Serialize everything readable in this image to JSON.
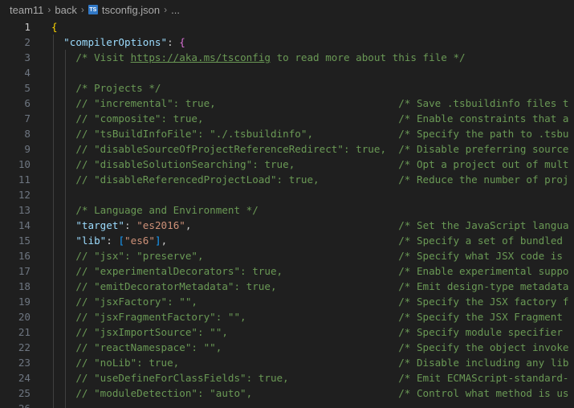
{
  "breadcrumb": {
    "items": [
      "team11",
      "back",
      "tsconfig.json",
      "..."
    ],
    "file_icon": "TS"
  },
  "editor": {
    "lines": [
      {
        "n": "1",
        "text": "{"
      },
      {
        "n": "2",
        "text": "  \"compilerOptions\": {"
      },
      {
        "n": "3",
        "text": "    /* Visit https://aka.ms/tsconfig to read more about this file */"
      },
      {
        "n": "4",
        "text": ""
      },
      {
        "n": "5",
        "text": "    /* Projects */"
      },
      {
        "n": "6",
        "text": "    // \"incremental\": true,                              /* Save .tsbuildinfo files t"
      },
      {
        "n": "7",
        "text": "    // \"composite\": true,                                /* Enable constraints that a"
      },
      {
        "n": "8",
        "text": "    // \"tsBuildInfoFile\": \"./.tsbuildinfo\",              /* Specify the path to .tsbu"
      },
      {
        "n": "9",
        "text": "    // \"disableSourceOfProjectReferenceRedirect\": true,  /* Disable preferring source"
      },
      {
        "n": "10",
        "text": "    // \"disableSolutionSearching\": true,                 /* Opt a project out of mult"
      },
      {
        "n": "11",
        "text": "    // \"disableReferencedProjectLoad\": true,             /* Reduce the number of proj"
      },
      {
        "n": "12",
        "text": ""
      },
      {
        "n": "13",
        "text": "    /* Language and Environment */"
      },
      {
        "n": "14",
        "text": "    \"target\": \"es2016\",                                  /* Set the JavaScript langua"
      },
      {
        "n": "15",
        "text": "    \"lib\": [\"es6\"],                                      /* Specify a set of bundled"
      },
      {
        "n": "16",
        "text": "    // \"jsx\": \"preserve\",                                /* Specify what JSX code is"
      },
      {
        "n": "17",
        "text": "    // \"experimentalDecorators\": true,                   /* Enable experimental suppo"
      },
      {
        "n": "18",
        "text": "    // \"emitDecoratorMetadata\": true,                    /* Emit design-type metadata"
      },
      {
        "n": "19",
        "text": "    // \"jsxFactory\": \"\",                                 /* Specify the JSX factory f"
      },
      {
        "n": "20",
        "text": "    // \"jsxFragmentFactory\": \"\",                         /* Specify the JSX Fragment"
      },
      {
        "n": "21",
        "text": "    // \"jsxImportSource\": \"\",                            /* Specify module specifier"
      },
      {
        "n": "22",
        "text": "    // \"reactNamespace\": \"\",                             /* Specify the object invoke"
      },
      {
        "n": "23",
        "text": "    // \"noLib\": true,                                    /* Disable including any lib"
      },
      {
        "n": "24",
        "text": "    // \"useDefineForClassFields\": true,                  /* Emit ECMAScript-standard-"
      },
      {
        "n": "25",
        "text": "    // \"moduleDetection\": \"auto\",                        /* Control what method is us"
      },
      {
        "n": "26",
        "text": ""
      }
    ]
  },
  "colors": {
    "background": "#1f1f1f",
    "property_key": "#9cdcfe",
    "string": "#ce9178",
    "comment": "#6a9955",
    "bracket_level1": "#ffd700",
    "bracket_level2": "#da70d6",
    "bracket_level3": "#179fff"
  }
}
